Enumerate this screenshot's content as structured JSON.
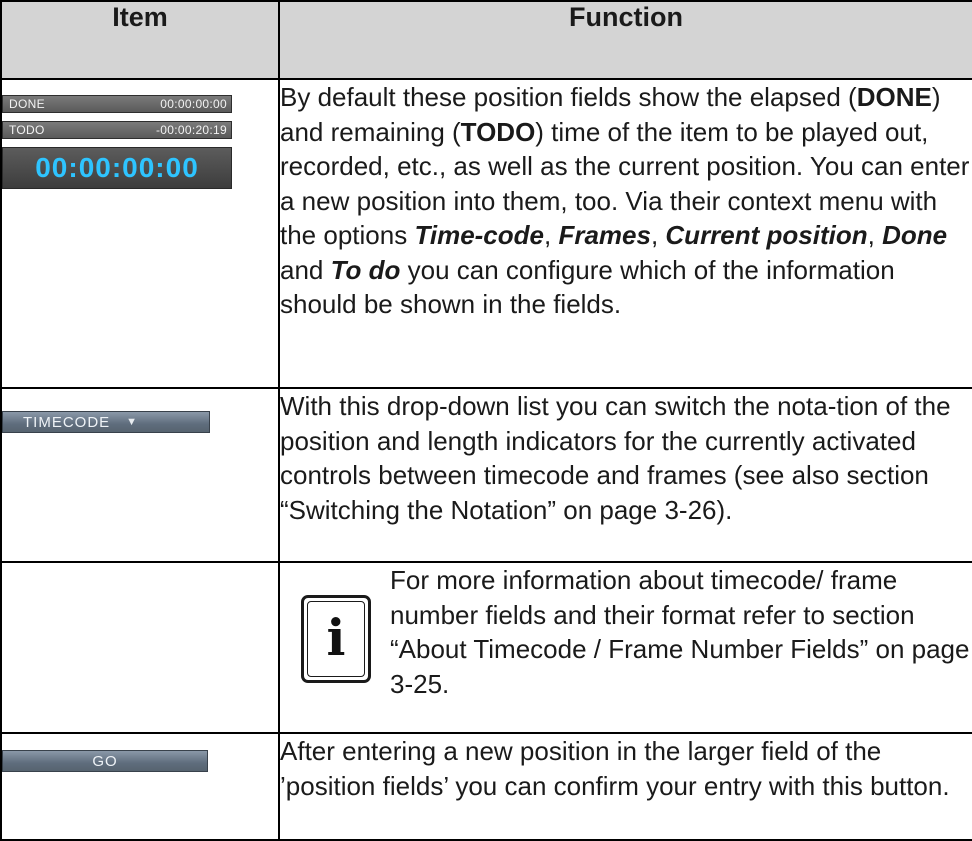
{
  "table": {
    "header_item": "Item",
    "header_function": "Function"
  },
  "row1": {
    "done_label": "DONE",
    "done_value": "00:00:00:00",
    "todo_label": "TODO",
    "todo_value": "-00:00:20:19",
    "position_value": "00:00:00:00",
    "text_a": "By default these position fields show the elapsed (",
    "kw_done": "DONE",
    "text_b": ") and remaining (",
    "kw_todo": "TODO",
    "text_c": ") time of the item to be played out, recorded, etc., as well as the current position. You can enter a new position into them, too. Via their context menu with the options ",
    "opt_timecode": "Time-code",
    "sep1": ", ",
    "opt_frames": "Frames",
    "sep2": ", ",
    "opt_current": "Current position",
    "sep3": ", ",
    "opt_done": "Done",
    "sep4": " and ",
    "opt_todo": "To do",
    "text_d": " you can configure which of the information should be shown in the fields."
  },
  "row2": {
    "dropdown_label": "TIMECODE",
    "dropdown_caret": "▼",
    "text": "With this drop-down list you can switch the nota-tion of the position and length indicators for the currently activated controls between timecode and frames (see also section “Switching the Notation” on page 3-26)."
  },
  "row3": {
    "icon": "info-icon",
    "icon_glyph": "i",
    "text": "For more information about timecode/ frame number fields and their format refer to section “About Timecode / Frame Number Fields” on page 3-25."
  },
  "row4": {
    "button_label": "GO",
    "text": "After entering a new position in the larger field of the ’position fields’ you can confirm your entry with this button."
  },
  "colors": {
    "header_bg": "#d4d4d4",
    "position_text": "#2ec4ff",
    "widget_blue": "#5f6d7d"
  }
}
